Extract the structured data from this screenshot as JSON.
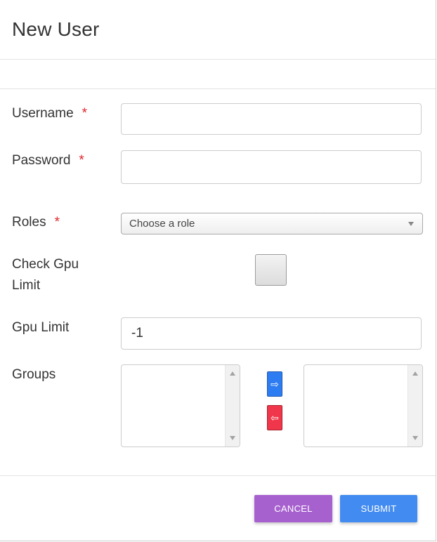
{
  "dialog": {
    "title": "New User"
  },
  "form": {
    "username": {
      "label": "Username",
      "required_mark": "*",
      "value": ""
    },
    "password": {
      "label": "Password",
      "required_mark": "*",
      "value": ""
    },
    "roles": {
      "label": "Roles",
      "required_mark": "*",
      "selected": "Choose a role"
    },
    "check_gpu_limit": {
      "label_line1": "Check Gpu",
      "label_line2": "Limit",
      "checked": false
    },
    "gpu_limit": {
      "label": "Gpu Limit",
      "value": "-1"
    },
    "groups": {
      "label": "Groups",
      "available": [],
      "selected": [],
      "move_right_icon": "⇨",
      "move_left_icon": "⇦"
    }
  },
  "footer": {
    "cancel_label": "CANCEL",
    "submit_label": "SUBMIT"
  },
  "colors": {
    "cancel": "#a761cf",
    "submit": "#428bf1",
    "move_right": "#2e7cf1",
    "move_left": "#f0364a",
    "required": "#e0242e"
  }
}
